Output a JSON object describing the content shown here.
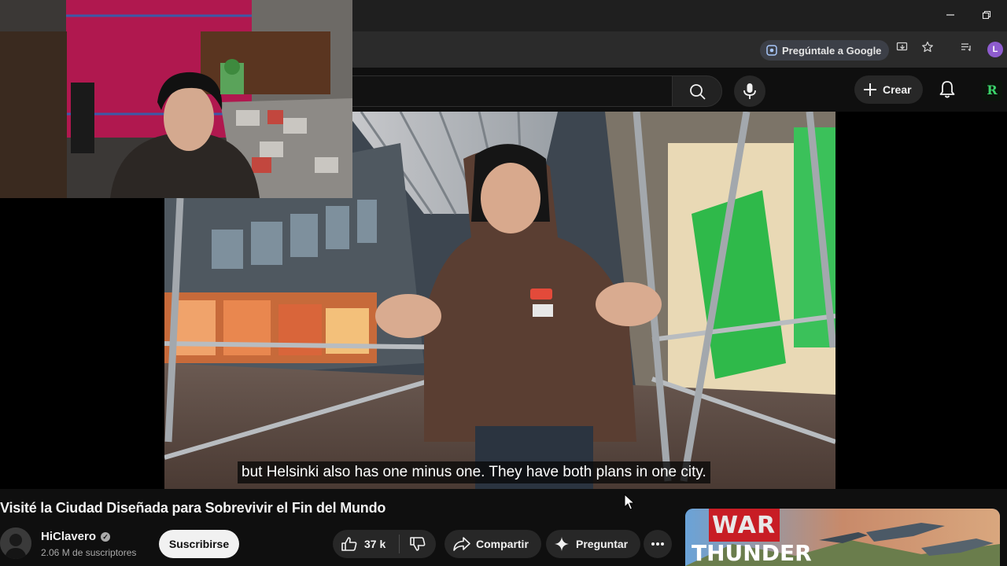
{
  "browser": {
    "ask_google_label": "Pregúntale a Google",
    "profile_initial": "L",
    "window_controls": [
      "minimize-icon",
      "restore-icon"
    ]
  },
  "header": {
    "create_label": "Crear",
    "channel_logo_letter": "R"
  },
  "player": {
    "subtitle": "but Helsinki also has one minus one. They have both plans in one city."
  },
  "video": {
    "title": "Visité la Ciudad Diseñada para Sobrevivir el Fin del Mundo",
    "channel_name": "HiClavero",
    "subscribers": "2.06 M de suscriptores",
    "subscribe_label": "Suscribirse",
    "likes": "37 k",
    "share_label": "Compartir",
    "ask_label": "Preguntar"
  },
  "ad": {
    "brand_line_1": "WAR",
    "brand_line_2": "THUNDER"
  },
  "colors": {
    "background": "#0f0f0f",
    "pill": "#272727",
    "subscribe_bg": "#f1f1f1",
    "profile": "#8e5ccf",
    "ask_google_bg": "#3c3f47"
  }
}
